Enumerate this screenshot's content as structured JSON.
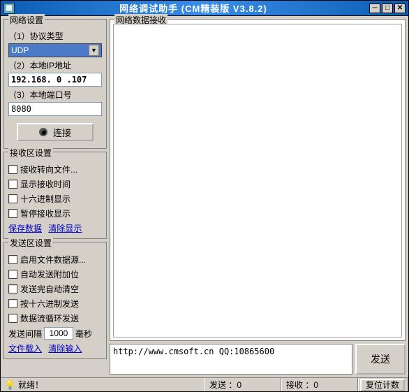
{
  "window": {
    "title": "网络调试助手  (CM精装版  V3.8.2)"
  },
  "network_settings": {
    "legend": "网络设置",
    "protocol_label": "（1）协议类型",
    "protocol_value": "UDP",
    "ip_label": "（2）本地IP地址",
    "ip_value": "192.168. 0 .107",
    "port_label": "（3）本地端口号",
    "port_value": "8080",
    "connect_label": "连接"
  },
  "recv_settings": {
    "legend": "接收区设置",
    "items": [
      "接收转向文件...",
      "显示接收时间",
      "十六进制显示",
      "暂停接收显示"
    ],
    "links": {
      "save": "保存数据",
      "clear": "清除显示"
    }
  },
  "send_settings": {
    "legend": "发送区设置",
    "items": [
      "启用文件数据源...",
      "自动发送附加位",
      "发送完自动清空",
      "按十六进制发送",
      "数据流循环发送"
    ],
    "interval": {
      "prefix": "发送间隔",
      "value": "1000",
      "suffix": "毫秒"
    },
    "links": {
      "load": "文件载入",
      "clear": "清除输入"
    }
  },
  "recv_area": {
    "legend": "网络数据接收"
  },
  "send_area": {
    "text": "http://www.cmsoft.cn QQ:10865600",
    "button": "发送"
  },
  "status": {
    "ready": "就绪！",
    "tx": "发送 ：0",
    "rx": "接收 ：0",
    "reset": "复位计数"
  }
}
